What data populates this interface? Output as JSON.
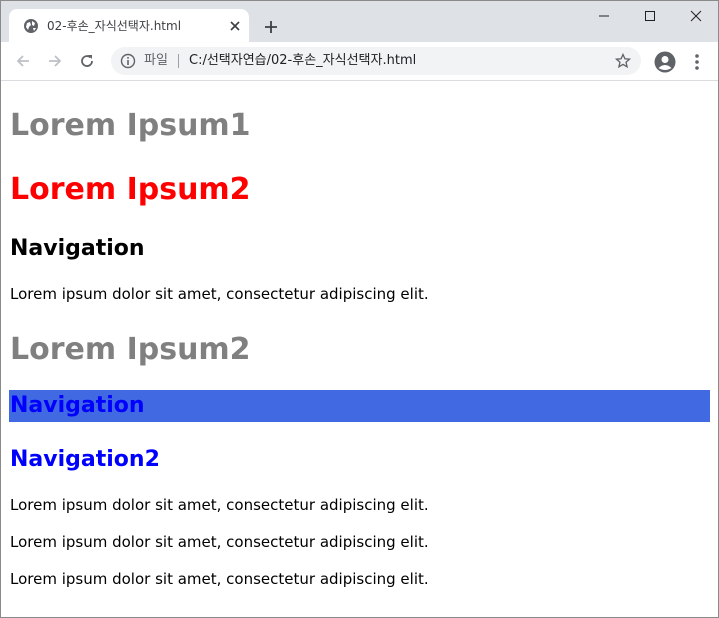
{
  "browser": {
    "tab": {
      "title": "02-후손_자식선택자.html"
    },
    "address_bar": {
      "scheme_label": "파일",
      "url": "C:/선택자연습/02-후손_자식선택자.html"
    },
    "icons": {
      "favicon": "globe-icon",
      "close": "close-icon",
      "new_tab": "plus-icon",
      "back": "back-arrow-icon",
      "forward": "forward-arrow-icon",
      "reload": "reload-icon",
      "info": "info-icon",
      "bookmark": "star-icon",
      "profile": "account-icon",
      "menu": "kebab-menu-icon"
    }
  },
  "page": {
    "heading1": "Lorem Ipsum1",
    "heading2": "Lorem Ipsum2",
    "nav1": "Navigation",
    "para1": "Lorem ipsum dolor sit amet, consectetur adipiscing elit.",
    "heading3": "Lorem Ipsum2",
    "nav_highlight": "Navigation",
    "nav2": "Navigation2",
    "para2": "Lorem ipsum dolor sit amet, consectetur adipiscing elit.",
    "para3": "Lorem ipsum dolor sit amet, consectetur adipiscing elit.",
    "para4": "Lorem ipsum dolor sit amet, consectetur adipiscing elit."
  },
  "colors": {
    "gray_heading": "#808080",
    "red_heading": "#ff0000",
    "blue_text": "#0000ff",
    "highlight_bg": "#4169e1"
  }
}
